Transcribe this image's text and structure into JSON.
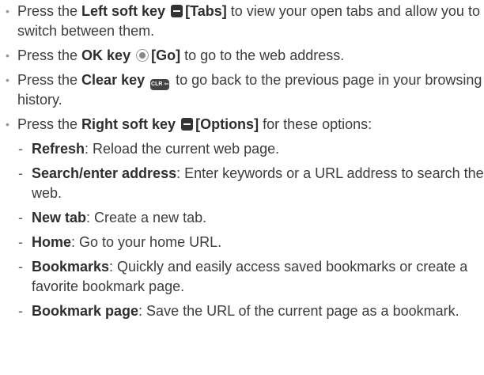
{
  "items": [
    {
      "pre": "Press the ",
      "key": "Left soft key",
      "icon": "left-soft-key-icon",
      "label": "[Tabs]",
      "post": " to view your open tabs and allow you to switch between them."
    },
    {
      "pre": "Press the ",
      "key": "OK key",
      "icon": "ok-key-icon",
      "label": "[Go]",
      "post": " to go to the web address."
    },
    {
      "pre": "Press the ",
      "key": "Clear key",
      "icon": "clear-key-icon",
      "icon_text": "CLR ⇦",
      "label": "",
      "post": " to go back to the previous page in your browsing history."
    },
    {
      "pre": "Press the ",
      "key": "Right soft key",
      "icon": "right-soft-key-icon",
      "label": "[Options]",
      "post": " for these options:"
    }
  ],
  "options": [
    {
      "term": "Refresh",
      "desc": ": Reload the current web page."
    },
    {
      "term": "Search/enter address",
      "desc": ": Enter keywords or a URL address to search the web."
    },
    {
      "term": "New tab",
      "desc": ": Create a new tab."
    },
    {
      "term": "Home",
      "desc": ": Go to your home URL."
    },
    {
      "term": "Bookmarks",
      "desc": ": Quickly and easily access saved bookmarks or create a favorite bookmark page."
    },
    {
      "term": "Bookmark page",
      "desc": ": Save the URL of the current page as a bookmark."
    }
  ]
}
